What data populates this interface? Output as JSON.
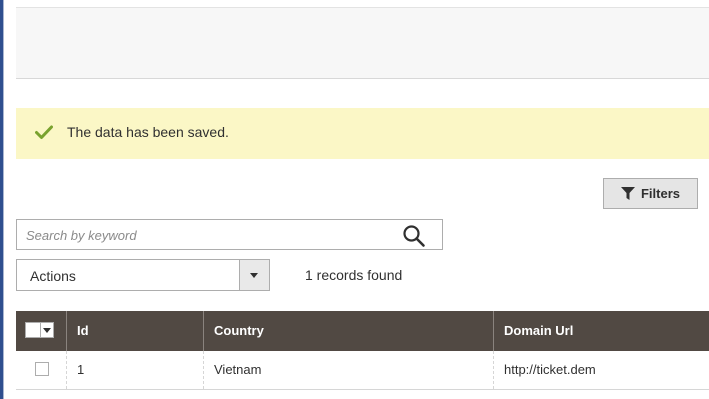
{
  "message": {
    "text": "The data has been saved.",
    "icon": "checkmark-icon",
    "color": "#79a22e",
    "background": "#fbf7c6"
  },
  "toolbar": {
    "filters_label": "Filters",
    "filters_icon": "funnel-icon",
    "search_placeholder": "Search by keyword",
    "search_value": "",
    "search_icon": "search-icon",
    "actions_label": "Actions",
    "records_found": "1 records found"
  },
  "grid": {
    "header_color": "#514943",
    "columns": [
      "Id",
      "Country",
      "Domain Url"
    ],
    "rows": [
      {
        "id": "1",
        "country": "Vietnam",
        "domain_url": "http://ticket.dem",
        "checked": false
      }
    ]
  }
}
